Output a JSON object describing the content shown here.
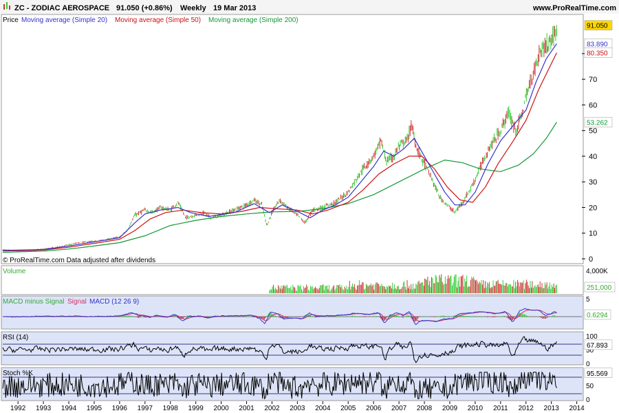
{
  "header": {
    "symbol_text": "ZC - ZODIAC AEROSPACE",
    "price_text": "91.050 (+0.86%)",
    "period_text": "Weekly",
    "date_text": "19 Mar 2013",
    "site_text": "www.ProRealTime.com"
  },
  "footer": {
    "copyright_text": "© ProRealTime.com Data adjusted after dividends"
  },
  "colors": {
    "background": "#ffffff",
    "panel_bg": "#dde4f7",
    "up_candle": "#32cd32",
    "down_candle": "#cc3333",
    "ma20": "#3333cc",
    "ma50": "#cc1111",
    "ma200": "#119933",
    "volume_title": "#33aa33",
    "rsi_line": "#000000",
    "current_badge": "#ffd700"
  },
  "chart_data": [
    {
      "id": "price",
      "type": "line",
      "legend": {
        "prefix": "Price",
        "ma20": "Moving average (Simple 20)",
        "ma50": "Moving average (Simple 50)",
        "ma200": "Moving average (Simple 200)"
      },
      "yticks": [
        "0",
        "10",
        "20",
        "30",
        "40",
        "50",
        "60",
        "70",
        "80"
      ],
      "ylim": [
        0,
        95
      ],
      "badges": [
        {
          "text": "91.050",
          "value": 91.05,
          "color": "#ffd700",
          "text_color": "#000000"
        },
        {
          "text": "83.890",
          "value": 83.89,
          "color": "#ffffff",
          "text_color": "#3333cc"
        },
        {
          "text": "80.350",
          "value": 80.35,
          "color": "#ffffff",
          "text_color": "#cc1111"
        },
        {
          "text": "53.262",
          "value": 53.262,
          "color": "#ffffff",
          "text_color": "#119933"
        }
      ],
      "price_points": [
        [
          1991.4,
          3.5
        ],
        [
          1992.0,
          3.0
        ],
        [
          1992.5,
          3.2
        ],
        [
          1993.0,
          3.8
        ],
        [
          1993.5,
          4.5
        ],
        [
          1994.0,
          5.5
        ],
        [
          1994.5,
          6.5
        ],
        [
          1995.0,
          6.8
        ],
        [
          1995.5,
          7.5
        ],
        [
          1996.0,
          8.5
        ],
        [
          1996.3,
          11
        ],
        [
          1996.6,
          17
        ],
        [
          1997.0,
          19
        ],
        [
          1997.3,
          18
        ],
        [
          1997.6,
          20
        ],
        [
          1998.0,
          19
        ],
        [
          1998.3,
          22
        ],
        [
          1998.6,
          16
        ],
        [
          1999.0,
          17
        ],
        [
          1999.3,
          18
        ],
        [
          1999.6,
          16
        ],
        [
          2000.0,
          17
        ],
        [
          2000.5,
          19
        ],
        [
          2001.0,
          21
        ],
        [
          2001.3,
          23
        ],
        [
          2001.6,
          21
        ],
        [
          2001.8,
          13
        ],
        [
          2002.0,
          18
        ],
        [
          2002.3,
          23
        ],
        [
          2002.6,
          20
        ],
        [
          2003.0,
          17
        ],
        [
          2003.3,
          14
        ],
        [
          2003.6,
          19
        ],
        [
          2004.0,
          20
        ],
        [
          2004.5,
          22
        ],
        [
          2005.0,
          26
        ],
        [
          2005.5,
          34
        ],
        [
          2006.0,
          40
        ],
        [
          2006.3,
          46
        ],
        [
          2006.5,
          38
        ],
        [
          2006.8,
          40
        ],
        [
          2007.0,
          44
        ],
        [
          2007.3,
          46
        ],
        [
          2007.5,
          52
        ],
        [
          2007.7,
          43
        ],
        [
          2008.0,
          37
        ],
        [
          2008.3,
          31
        ],
        [
          2008.6,
          24
        ],
        [
          2009.0,
          20
        ],
        [
          2009.2,
          18
        ],
        [
          2009.5,
          22
        ],
        [
          2009.8,
          27
        ],
        [
          2010.0,
          31
        ],
        [
          2010.3,
          38
        ],
        [
          2010.6,
          44
        ],
        [
          2011.0,
          50
        ],
        [
          2011.3,
          57
        ],
        [
          2011.6,
          50
        ],
        [
          2011.8,
          55
        ],
        [
          2012.0,
          63
        ],
        [
          2012.3,
          73
        ],
        [
          2012.6,
          82
        ],
        [
          2012.9,
          84
        ],
        [
          2013.1,
          87
        ],
        [
          2013.21,
          91.05
        ]
      ],
      "ma20_points": [
        [
          1991.4,
          3.3
        ],
        [
          1993.0,
          3.6
        ],
        [
          1994.0,
          5.0
        ],
        [
          1995.0,
          6.6
        ],
        [
          1996.0,
          8.2
        ],
        [
          1996.6,
          14
        ],
        [
          1997.0,
          17.5
        ],
        [
          1997.6,
          19
        ],
        [
          1998.3,
          20
        ],
        [
          1998.8,
          18
        ],
        [
          1999.5,
          16.5
        ],
        [
          2000.5,
          18
        ],
        [
          2001.3,
          21.5
        ],
        [
          2001.9,
          18
        ],
        [
          2002.4,
          21
        ],
        [
          2003.0,
          18.5
        ],
        [
          2003.5,
          16
        ],
        [
          2004.0,
          19
        ],
        [
          2004.5,
          21
        ],
        [
          2005.0,
          24
        ],
        [
          2005.5,
          30
        ],
        [
          2006.0,
          36
        ],
        [
          2006.4,
          42
        ],
        [
          2006.8,
          40
        ],
        [
          2007.2,
          43
        ],
        [
          2007.6,
          47
        ],
        [
          2008.0,
          40
        ],
        [
          2008.4,
          33
        ],
        [
          2008.8,
          26
        ],
        [
          2009.2,
          21
        ],
        [
          2009.6,
          21
        ],
        [
          2010.0,
          26
        ],
        [
          2010.5,
          37
        ],
        [
          2011.0,
          46
        ],
        [
          2011.5,
          52
        ],
        [
          2012.0,
          58
        ],
        [
          2012.4,
          69
        ],
        [
          2012.8,
          78
        ],
        [
          2013.21,
          83.89
        ]
      ],
      "ma50_points": [
        [
          1991.4,
          3.0
        ],
        [
          1993.0,
          3.4
        ],
        [
          1994.0,
          4.5
        ],
        [
          1995.0,
          6.0
        ],
        [
          1996.0,
          7.6
        ],
        [
          1996.6,
          11
        ],
        [
          1997.2,
          15.5
        ],
        [
          1997.8,
          18
        ],
        [
          1998.5,
          19
        ],
        [
          1999.2,
          18
        ],
        [
          2000.0,
          17.5
        ],
        [
          2000.8,
          18.5
        ],
        [
          2001.5,
          20
        ],
        [
          2002.2,
          19.5
        ],
        [
          2003.0,
          19
        ],
        [
          2003.6,
          17.5
        ],
        [
          2004.2,
          19
        ],
        [
          2005.0,
          22
        ],
        [
          2005.6,
          27
        ],
        [
          2006.2,
          33
        ],
        [
          2006.8,
          37
        ],
        [
          2007.4,
          40
        ],
        [
          2007.9,
          40
        ],
        [
          2008.4,
          35
        ],
        [
          2008.9,
          28
        ],
        [
          2009.4,
          23
        ],
        [
          2009.9,
          22
        ],
        [
          2010.4,
          28
        ],
        [
          2010.9,
          37
        ],
        [
          2011.5,
          46
        ],
        [
          2012.0,
          54
        ],
        [
          2012.5,
          66
        ],
        [
          2013.21,
          80.35
        ]
      ],
      "ma200_points": [
        [
          1991.4,
          2.5
        ],
        [
          1993.0,
          3.0
        ],
        [
          1994.0,
          3.8
        ],
        [
          1995.0,
          5.0
        ],
        [
          1996.0,
          6.3
        ],
        [
          1997.0,
          9
        ],
        [
          1998.0,
          13
        ],
        [
          1999.0,
          15
        ],
        [
          2000.0,
          16.5
        ],
        [
          2001.0,
          17.5
        ],
        [
          2002.0,
          18.3
        ],
        [
          2003.0,
          18.5
        ],
        [
          2004.0,
          19.5
        ],
        [
          2005.0,
          21.5
        ],
        [
          2006.0,
          25
        ],
        [
          2007.0,
          30
        ],
        [
          2008.0,
          35
        ],
        [
          2008.8,
          38.5
        ],
        [
          2009.5,
          37.5
        ],
        [
          2010.2,
          35
        ],
        [
          2011.0,
          34
        ],
        [
          2011.7,
          36.5
        ],
        [
          2012.3,
          41
        ],
        [
          2012.8,
          47
        ],
        [
          2013.21,
          53.262
        ]
      ]
    },
    {
      "id": "volume",
      "type": "bar",
      "title": "Volume",
      "yticks": [
        "4,000K"
      ],
      "badges": [
        {
          "text": "251,000",
          "value": 251000,
          "color": "#ffffff",
          "text_color": "#33aa33"
        }
      ]
    },
    {
      "id": "macd",
      "type": "line",
      "legend": {
        "part1": "MACD minus Signal",
        "part2": "Signal",
        "part3": "MACD (12 26 9)"
      },
      "yticks": [
        "5",
        "0",
        "-5"
      ],
      "badges": [
        {
          "text": "0.6294",
          "value": 0.6294,
          "color": "#ffffff",
          "text_color": "#33aa33"
        }
      ]
    },
    {
      "id": "rsi",
      "type": "line",
      "legend": "RSI (14)",
      "yticks": [
        "100",
        "50",
        "0"
      ],
      "levels": [
        70,
        30
      ],
      "badges": [
        {
          "text": "67.893",
          "value": 67.893,
          "color": "#ffffff",
          "text_color": "#000000"
        }
      ]
    },
    {
      "id": "stoch",
      "type": "line",
      "legend": "Stoch %K",
      "yticks": [
        "50",
        "0"
      ],
      "levels": [
        80,
        20
      ],
      "badges": [
        {
          "text": "95.569",
          "value": 95.569,
          "color": "#ffffff",
          "text_color": "#000000"
        }
      ]
    }
  ],
  "x_axis": {
    "years": [
      "1992",
      "1993",
      "1994",
      "1995",
      "1996",
      "1997",
      "1998",
      "1999",
      "2000",
      "2001",
      "2002",
      "2003",
      "2004",
      "2005",
      "2006",
      "2007",
      "2008",
      "2009",
      "2010",
      "2011",
      "2012",
      "2013",
      "2014"
    ],
    "xlim": [
      1991.4,
      2014.2
    ]
  }
}
